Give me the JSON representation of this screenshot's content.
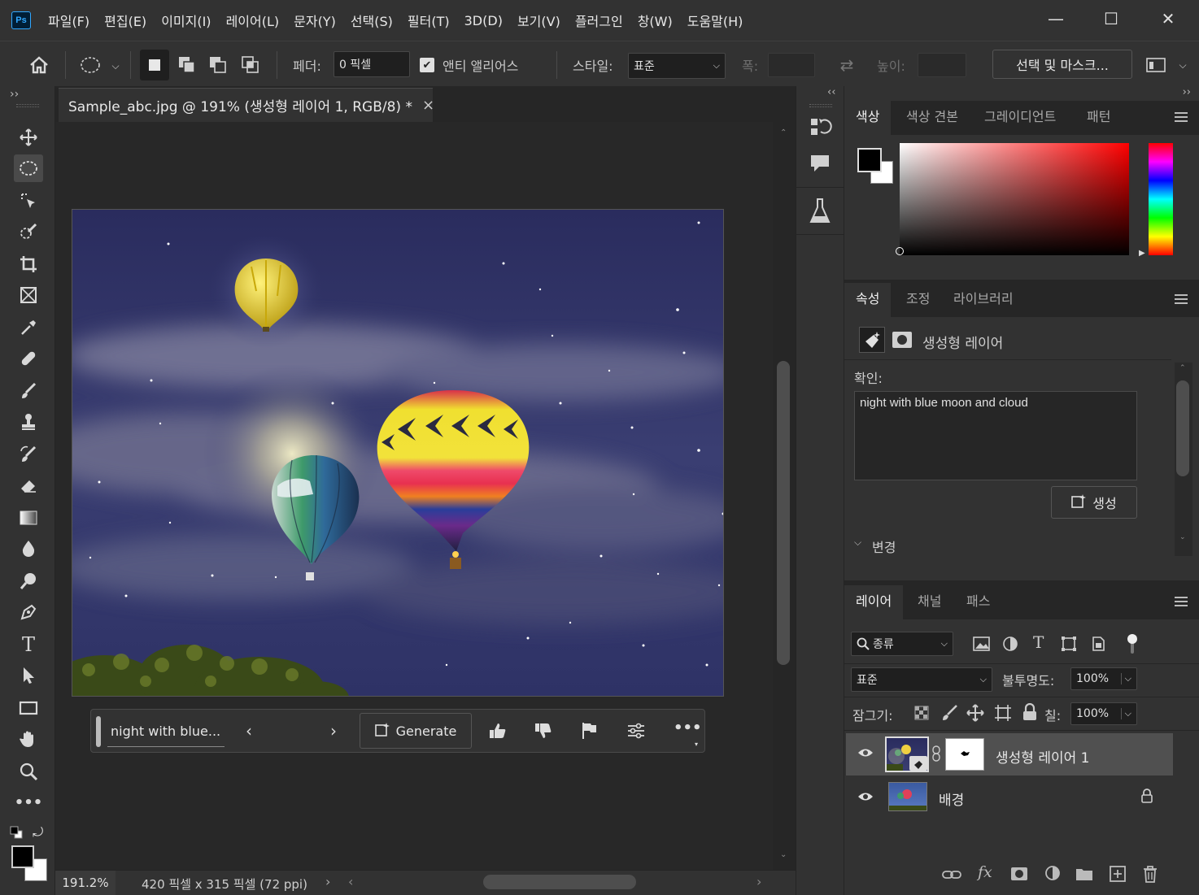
{
  "app": {
    "logo": "Ps"
  },
  "menu": [
    "파일(F)",
    "편집(E)",
    "이미지(I)",
    "레이어(L)",
    "문자(Y)",
    "선택(S)",
    "필터(T)",
    "3D(D)",
    "보기(V)",
    "플러그인",
    "창(W)",
    "도움말(H)"
  ],
  "window": {
    "minimize": "—",
    "maximize": "☐",
    "close": "✕"
  },
  "options": {
    "feather_label": "페더:",
    "feather_value": "0 픽셀",
    "antialias_label": "앤티 앨리어스",
    "antialias_checked": true,
    "style_label": "스타일:",
    "style_value": "표준",
    "width_label": "폭:",
    "height_label": "높이:",
    "select_mask": "선택 및 마스크..."
  },
  "document": {
    "tab_title": "Sample_abc.jpg @ 191% (생성형 레이어 1, RGB/8) *",
    "close": "×"
  },
  "contextual_taskbar": {
    "prompt": "night with blue...",
    "generate": "Generate"
  },
  "status": {
    "zoom": "191.2%",
    "doc_info": "420 픽셀 x 315 픽셀 (72 ppi)"
  },
  "color_panel": {
    "tabs": [
      "색상",
      "색상 견본",
      "그레이디언트",
      "패턴"
    ],
    "active": 0,
    "foreground": "#000000",
    "background": "#ffffff",
    "hue_color": "#ff0000"
  },
  "properties_panel": {
    "tabs": [
      "속성",
      "조정",
      "라이브러리"
    ],
    "active": 0,
    "layer_type": "생성형 레이어",
    "prompt_label": "확인:",
    "prompt_text": "night with blue moon and cloud",
    "generate_btn": "생성",
    "variations_label": "변경"
  },
  "layers_panel": {
    "tabs": [
      "레이어",
      "채널",
      "패스"
    ],
    "active": 0,
    "filter_label": "종류",
    "blend_mode": "표준",
    "opacity_label": "불투명도:",
    "opacity": "100%",
    "lock_label": "잠그기:",
    "fill_label": "칠:",
    "fill": "100%",
    "layers": [
      {
        "name": "생성형 레이어 1",
        "selected": true,
        "locked": false
      },
      {
        "name": "배경",
        "selected": false,
        "locked": true
      }
    ]
  }
}
